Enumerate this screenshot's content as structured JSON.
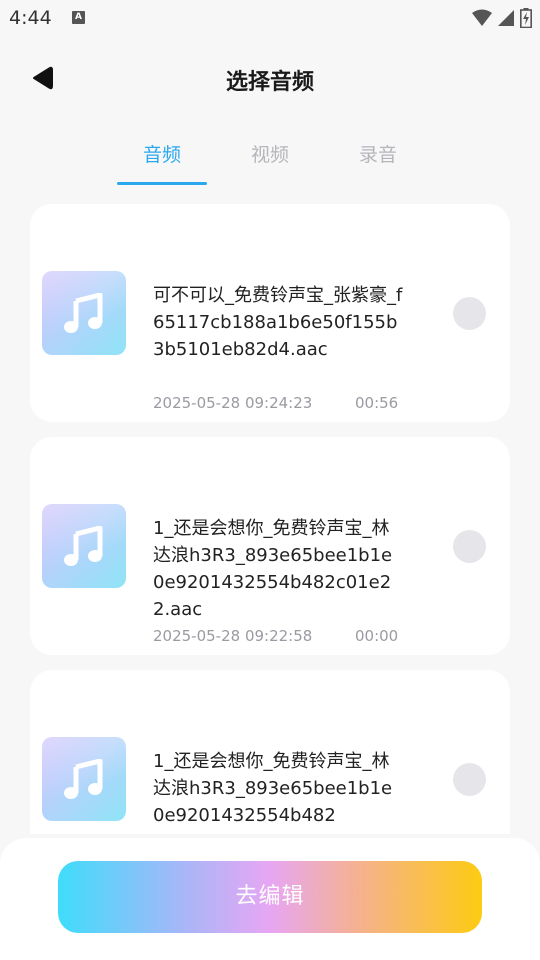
{
  "status_bar": {
    "time": "4:44",
    "badge": "A",
    "icons": [
      "wifi-icon",
      "signal-icon",
      "battery-icon"
    ]
  },
  "header": {
    "title": "选择音频",
    "back_icon": "back-arrow-icon"
  },
  "tabs": [
    {
      "label": "音频",
      "active": true
    },
    {
      "label": "视频",
      "active": false
    },
    {
      "label": "录音",
      "active": false
    }
  ],
  "audio_list": [
    {
      "title": "可不可以_免费铃声宝_张紫豪_f65117cb188a1b6e50f155b3b5101eb82d4.aac",
      "date": "2025-05-28 09:24:23",
      "duration": "00:56",
      "icon": "music-note-icon",
      "selected": false
    },
    {
      "title": "1_还是会想你_免费铃声宝_林达浪h3R3_893e65bee1b1e0e9201432554b482c01e22.aac",
      "date": "2025-05-28 09:22:58",
      "duration": "00:00",
      "icon": "music-note-icon",
      "selected": false
    },
    {
      "title": "1_还是会想你_免费铃声宝_林达浪h3R3_893e65bee1b1e0e9201432554b482",
      "icon": "music-note-icon",
      "selected": false
    }
  ],
  "bottom": {
    "edit_button_label": "去编辑"
  },
  "colors": {
    "accent": "#2aa8ee",
    "inactive_tab": "#b5b5bb",
    "gradient_start": "#3fdcfb",
    "gradient_end": "#fdcb12"
  }
}
